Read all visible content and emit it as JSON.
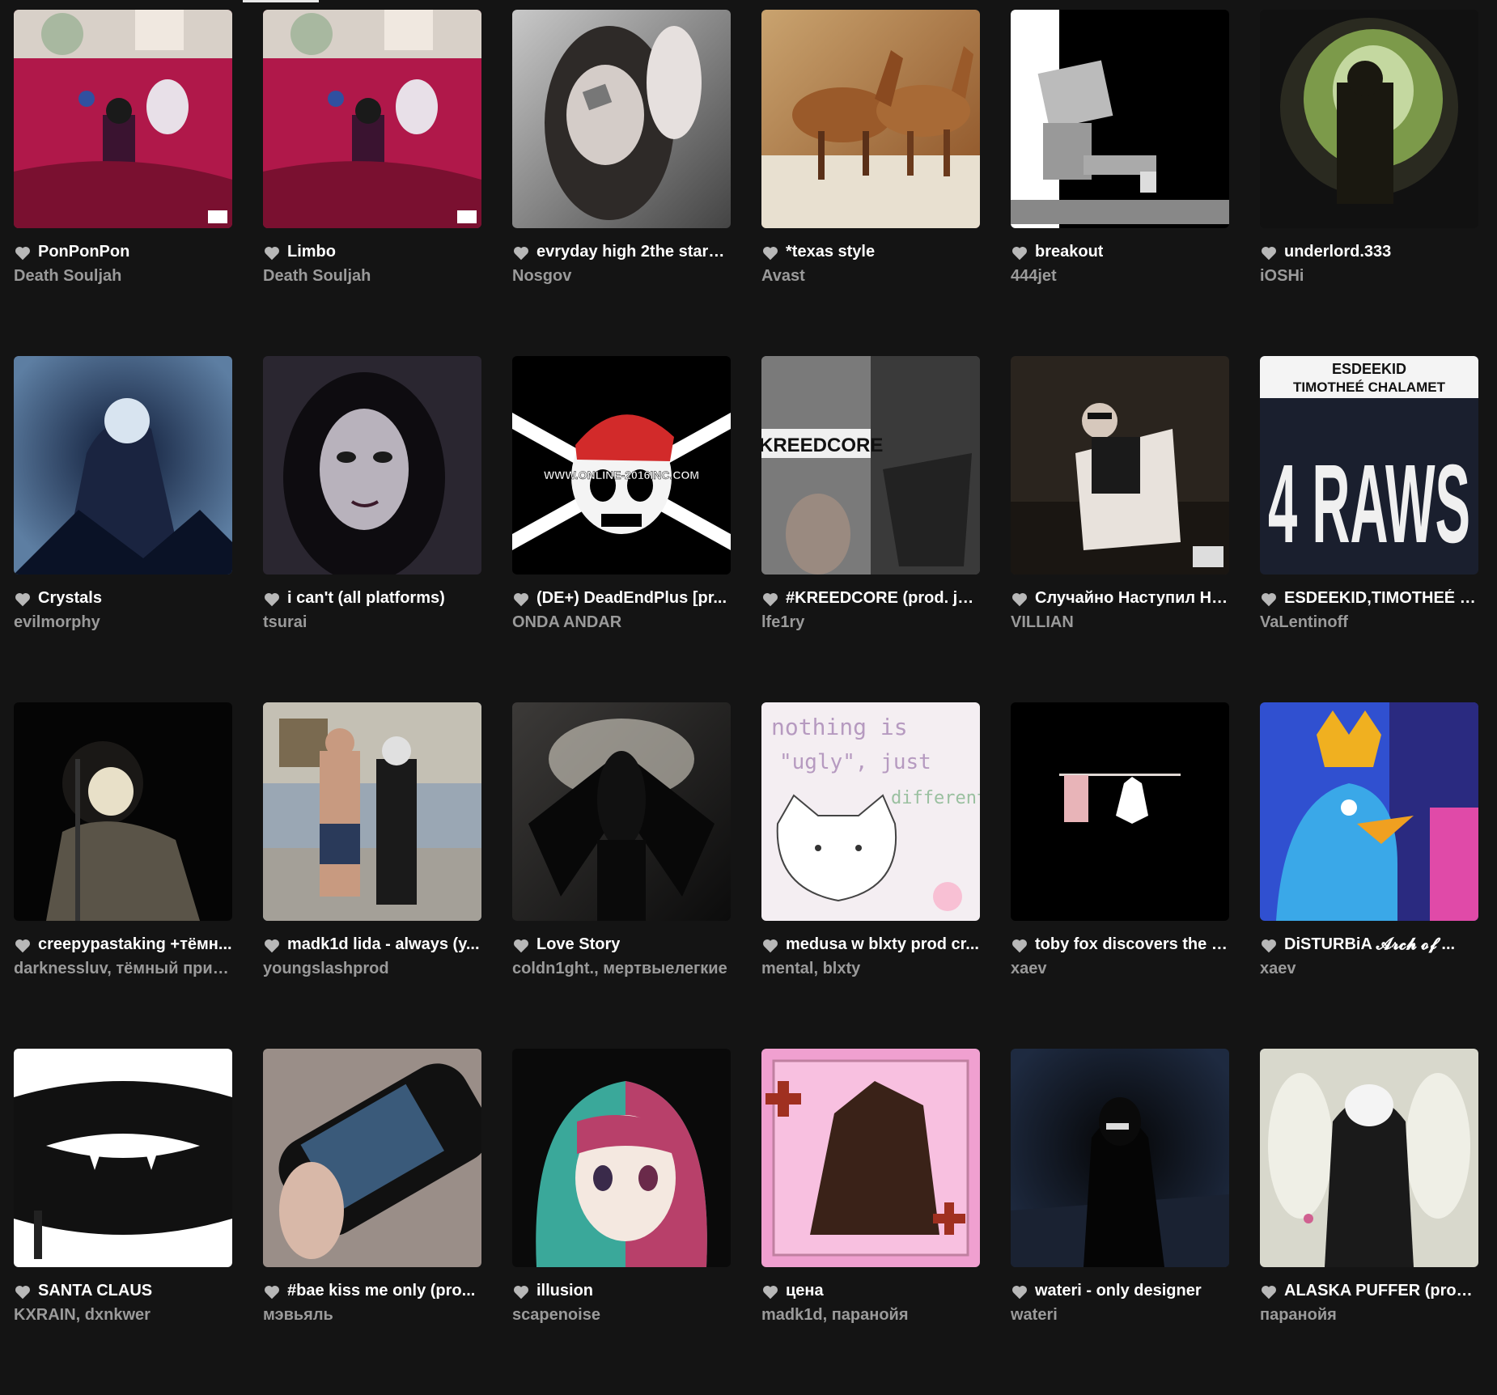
{
  "grid": {
    "tracks": [
      {
        "title": "PonPonPon",
        "artists": "Death Souljah",
        "cover": {
          "bg": "#b0184a",
          "accent": "#3a1330",
          "type": "collage"
        }
      },
      {
        "title": "Limbo",
        "artists": "Death Souljah",
        "cover": {
          "bg": "#b0184a",
          "accent": "#3a1330",
          "type": "collage"
        }
      },
      {
        "title": "evryday high 2the stars...",
        "artists": "Nosgov",
        "cover": {
          "bg": "#c8c8c8",
          "accent": "#444444",
          "type": "portrait"
        }
      },
      {
        "title": "*texas style",
        "artists": "Avast",
        "cover": {
          "bg": "#c9a36f",
          "accent": "#8a4e22",
          "type": "horses"
        }
      },
      {
        "title": "breakout",
        "artists": "444jet",
        "cover": {
          "bg": "#000000",
          "accent": "#ffffff",
          "type": "robot"
        }
      },
      {
        "title": "underlord.333",
        "artists": "iOSHi",
        "cover": {
          "bg": "#1b1b14",
          "accent": "#7c9a4a",
          "type": "tunnel"
        }
      },
      {
        "title": "Crystals",
        "artists": "evilmorphy",
        "cover": {
          "bg": "#5d7ea2",
          "accent": "#0e1a36",
          "type": "figure"
        }
      },
      {
        "title": "i can't (all platforms)",
        "artists": "tsurai",
        "cover": {
          "bg": "#2a2630",
          "accent": "#d8d4dc",
          "type": "face"
        }
      },
      {
        "title": "(DE+) DeadEndPlus [pr...",
        "artists": "ONDA ANDAR",
        "cover": {
          "bg": "#000000",
          "accent": "#d22a2a",
          "type": "skull",
          "text": "WWW.ONLINE-2016INC.COM"
        }
      },
      {
        "title": "#KREEDCORE (prod. je...",
        "artists": "lfe1ry",
        "cover": {
          "bg": "#6a6a6a",
          "accent": "#1a1a1a",
          "type": "kreed",
          "text": "#KREEDCORE"
        }
      },
      {
        "title": "Случайно Наступил На...",
        "artists": "VILLIAN",
        "cover": {
          "bg": "#2a241e",
          "accent": "#e8e2dc",
          "type": "bath"
        }
      },
      {
        "title": "ESDEEKID,TIMOTHEÉ C...",
        "artists": "VaLentinoff",
        "cover": {
          "bg": "#1a1f2e",
          "accent": "#ffffff",
          "type": "raws",
          "text": "4 RAWS",
          "text_top": "ESDEEKID TIMOTHEÉ CHALAMET"
        }
      },
      {
        "title": "creepypastaking +тёмн...",
        "artists": "darknessluv, тёмный принц",
        "cover": {
          "bg": "#050505",
          "accent": "#e8e0c8",
          "type": "singer"
        }
      },
      {
        "title": "madk1d lida - always (y...",
        "artists": "youngslashprod",
        "cover": {
          "bg": "#9aa7b4",
          "accent": "#3a3a3a",
          "type": "photo"
        }
      },
      {
        "title": "Love Story",
        "artists": "coldn1ght., мертвыелегкие",
        "cover": {
          "bg": "#3c3a38",
          "accent": "#0c0c0c",
          "type": "angel"
        }
      },
      {
        "title": "medusa w blxty prod cr...",
        "artists": "mental, blxty",
        "cover": {
          "bg": "#f4eef2",
          "accent": "#b69ac0",
          "type": "cat",
          "text": "nothing is \"ugly\", just different"
        }
      },
      {
        "title": "toby fox discovers the h...",
        "artists": "xaev",
        "cover": {
          "bg": "#000000",
          "accent": "#ffffff",
          "type": "curtain"
        }
      },
      {
        "title": "DiSTURBiA 𝓐𝓻𝓬𝓱 𝓸𝓯 ...",
        "artists": "xaev",
        "cover": {
          "bg": "#3050d0",
          "accent": "#e04aa8",
          "type": "bird"
        }
      },
      {
        "title": "SANTA CLAUS",
        "artists": "KXRAIN, dxnkwer",
        "cover": {
          "bg": "#ffffff",
          "accent": "#000000",
          "type": "lips"
        }
      },
      {
        "title": "#bae kiss me only (pro...",
        "artists": "мэвьяль",
        "cover": {
          "bg": "#9a8e88",
          "accent": "#1a1a1a",
          "type": "psp"
        }
      },
      {
        "title": "illusion",
        "artists": "scapenoise",
        "cover": {
          "bg": "#0a0a0a",
          "accent": "#3aa89a",
          "type": "anime"
        }
      },
      {
        "title": "цена",
        "artists": "madk1d, паранойя",
        "cover": {
          "bg": "#f0a0d0",
          "accent": "#3a2218",
          "type": "pink"
        }
      },
      {
        "title": "wateri - only designer",
        "artists": "wateri",
        "cover": {
          "bg": "#1e2a40",
          "accent": "#050505",
          "type": "night"
        }
      },
      {
        "title": "ALASKA PUFFER (prod...",
        "artists": "паранойя",
        "cover": {
          "bg": "#d8d8cc",
          "accent": "#1a1a1a",
          "type": "puffer"
        }
      }
    ]
  }
}
